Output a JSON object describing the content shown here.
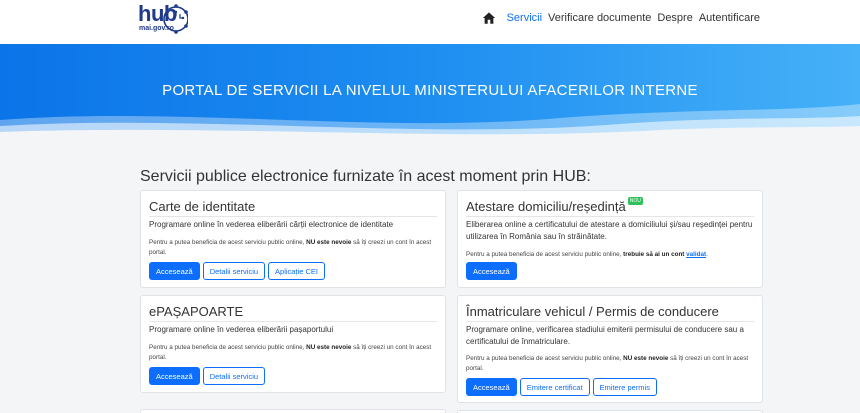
{
  "nav": {
    "logo_text": "hub",
    "logo_sub": "mai.gov.ro",
    "links": [
      {
        "label": "Servicii",
        "active": true
      },
      {
        "label": "Verificare documente",
        "active": false
      },
      {
        "label": "Despre",
        "active": false
      },
      {
        "label": "Autentificare",
        "active": false
      }
    ]
  },
  "hero": {
    "title": "PORTAL DE SERVICII LA NIVELUL MINISTERULUI AFACERILOR INTERNE"
  },
  "main": {
    "section_title": "Servicii publice electronice furnizate în acest moment prin  HUB:",
    "cards": [
      {
        "title": "Carte de identitate",
        "description": "Programare online în vederea eliberării cărții electronice de identitate",
        "note_pre": "Pentru a putea beneficia de acest serviciu public online, ",
        "note_bold": "NU este nevoie",
        "note_post": " să îți creezi un cont în acest portal.",
        "buttons": [
          "Accesează",
          "Detalii serviciu",
          "Aplicație CEI"
        ]
      },
      {
        "title": "Atestare domiciliu/reședință",
        "badge": "NOU",
        "description": "Eliberarea online a certificatului de atestare a domiciliului și/sau reședinței pentru utilizarea în  România sau în străinătate.",
        "note_pre": "Pentru a putea beneficia de acest serviciu public online, ",
        "note_bold": "trebuie să ai un cont ",
        "note_link": "validat",
        "note_post": ".",
        "buttons": [
          "Accesează"
        ]
      },
      {
        "title": "ePAȘAPOARTE",
        "description": "Programare online în vederea eliberării pașaportului",
        "note_pre": "Pentru a putea beneficia de acest serviciu public online, ",
        "note_bold": "NU este nevoie",
        "note_post": " să îți creezi un cont în acest portal.",
        "buttons": [
          "Accesează",
          "Detalii serviciu"
        ]
      },
      {
        "title": "Înmatriculare vehicul /  Permis de conducere",
        "description": "Programare online, verificarea stadiului emiterii permisului de conducere sau a certificatului de înmatriculare.",
        "note_pre": "Pentru a putea beneficia de acest serviciu public online, ",
        "note_bold": "NU este nevoie",
        "note_post": " să îți creezi un cont în acest portal.",
        "buttons": [
          "Accesează",
          "Emitere certificat",
          "Emitere permis"
        ]
      }
    ]
  }
}
